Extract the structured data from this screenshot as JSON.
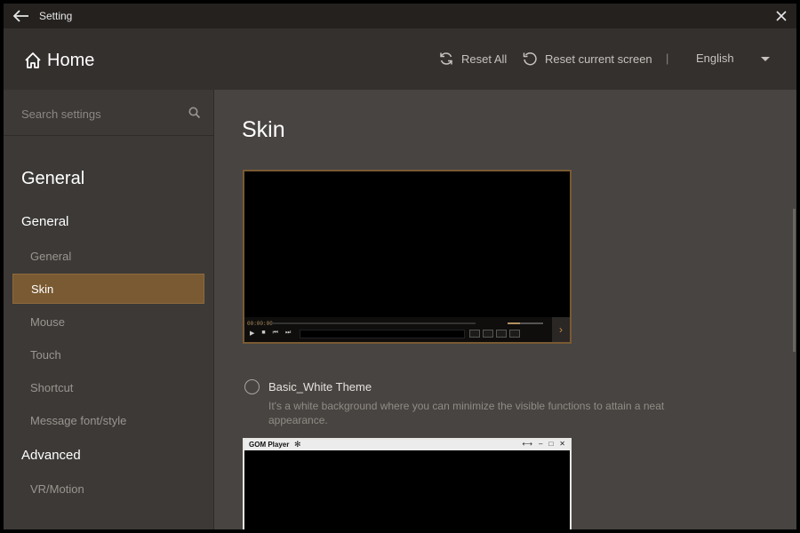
{
  "titlebar": {
    "title": "Setting"
  },
  "header": {
    "home_label": "Home",
    "reset_all": "Reset All",
    "reset_current": "Reset current screen",
    "divider": "|",
    "language": "English"
  },
  "sidebar": {
    "search_placeholder": "Search settings",
    "section_title": "General",
    "group_general": "General",
    "items": [
      "General",
      "Skin",
      "Mouse",
      "Touch",
      "Shortcut",
      "Message font/style"
    ],
    "group_advanced": "Advanced",
    "advanced_items": [
      "VR/Motion"
    ]
  },
  "main": {
    "title": "Skin",
    "preview1": {
      "time": "00:00:00"
    },
    "theme": {
      "name": "Basic_White Theme",
      "description": "It's a white background where you can minimize the visible functions to attain a neat appearance."
    },
    "preview2": {
      "logo": "GOM Player"
    }
  },
  "colors": {
    "accent": "#7a5a32",
    "accent_text": "#c98a45"
  }
}
